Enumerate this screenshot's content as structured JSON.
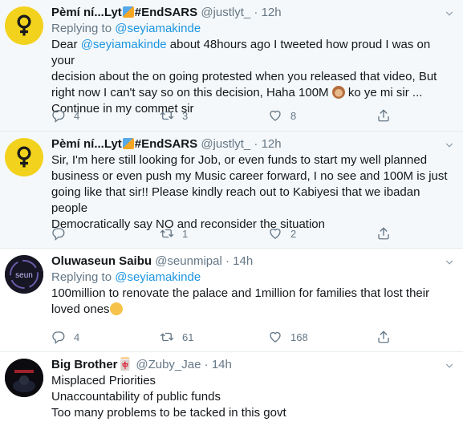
{
  "tweets": [
    {
      "name": "Pèmí ní...Lyt",
      "hashtag": "#EndSARS",
      "handle": "@justlyt_",
      "dot": "·",
      "time": "12h",
      "replying_prefix": "Replying to",
      "replying_to": "@seyiamakinde",
      "body_before_mention": "Dear ",
      "mention": "@seyiamakinde",
      "body_line1_rest": "  about 48hours ago I tweeted how proud I was on your",
      "body_line2": "decision about the on going protested when you released that video, But",
      "body_line3_a": "right now I can't say so on this decision, Haha 100M ",
      "body_line3_b": " ko ye mi sir ...",
      "body_line4": "Continue in my commet sir",
      "replies": "4",
      "retweets": "3",
      "likes": "8"
    },
    {
      "name": "Pèmí ní...Lyt",
      "hashtag": "#EndSARS",
      "handle": "@justlyt_",
      "dot": "·",
      "time": "12h",
      "body_line1": "Sir, I'm here still looking for Job, or even funds to start my well planned",
      "body_line2": "business or even push my Music career forward, I no see and 100M is just",
      "body_line3": "going like that sir!! Please kindly reach out to Kabiyesi that we ibadan people",
      "body_line4": "Democratically say NO and reconsider the situation",
      "replies": "",
      "retweets": "1",
      "likes": "2"
    },
    {
      "name": "Oluwaseun Saibu",
      "handle": "@seunmipal",
      "dot": "·",
      "time": "14h",
      "avatar_text": "seun",
      "replying_prefix": "Replying to",
      "replying_to": "@seyiamakinde",
      "body_line1": "100million to renovate the palace and 1million for families that lost their",
      "body_line2": "loved ones",
      "replies": "4",
      "retweets": "61",
      "likes": "168"
    },
    {
      "name": "Big Brother🀄",
      "handle": "@Zuby_Jae",
      "dot": "·",
      "time": "14h",
      "body_line1": "Misplaced Priorities",
      "body_line2": "Unaccountability of public funds",
      "body_line3": "Too many problems to be tacked in this govt"
    }
  ],
  "colors": {
    "link": "#1b95e0",
    "muted": "#657786",
    "text": "#14171a",
    "avatar_yellow": "#f2d21c"
  },
  "icons": [
    "reply-icon",
    "retweet-icon",
    "like-icon",
    "share-icon",
    "caret-down-icon",
    "venus-icon"
  ]
}
